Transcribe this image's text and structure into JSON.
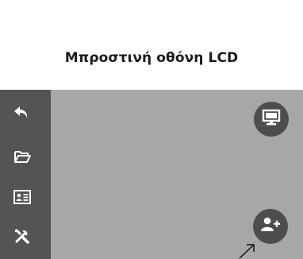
{
  "page": {
    "title": "Μπροστινή οθόνη LCD"
  },
  "sidebar": {
    "items": [
      {
        "name": "back",
        "icon": "back-arrow-icon"
      },
      {
        "name": "folder",
        "icon": "folder-open-icon"
      },
      {
        "name": "contact-card",
        "icon": "contact-card-icon"
      },
      {
        "name": "settings",
        "icon": "tools-icon"
      }
    ]
  },
  "screen": {
    "buttons": [
      {
        "name": "monitor",
        "icon": "monitor-icon"
      },
      {
        "name": "add-user",
        "icon": "add-user-icon"
      }
    ]
  },
  "colors": {
    "screen_bg": "#a7a7a7",
    "sidebar_bg": "#545454",
    "button_bg": "#4d4d4d",
    "icon": "#ffffff",
    "title": "#1a1a1a"
  }
}
